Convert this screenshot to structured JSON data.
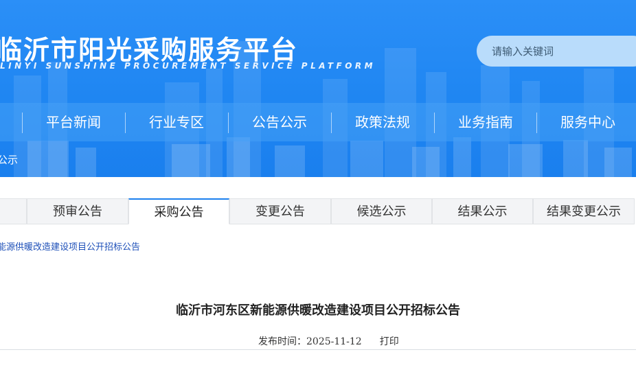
{
  "header": {
    "site_title": "临沂市阳光采购服务平台",
    "site_subtitle": "LINYI SUNSHINE PROCUREMENT SERVICE PLATFORM",
    "search_placeholder": "请输入关键词"
  },
  "nav": {
    "items": [
      "平台新闻",
      "行业专区",
      "公告公示",
      "政策法规",
      "业务指南",
      "服务中心"
    ]
  },
  "breadcrumb": {
    "current": "公示"
  },
  "tabs": {
    "items": [
      "预审公告",
      "采购公告",
      "变更公告",
      "候选公示",
      "结果公示",
      "结果变更公示"
    ],
    "active": "采购公告"
  },
  "notice": {
    "link_text": "能源供暖改造建设项目公开招标公告",
    "title": "临沂市河东区新能源供暖改造建设项目公开招标公告",
    "publish_label": "发布时间：",
    "publish_date": "2025-11-12",
    "print_label": "打印"
  },
  "colors": {
    "brand_blue": "#1f86f2",
    "active_tab_border": "#1a7fee",
    "link": "#1d4fb8"
  }
}
